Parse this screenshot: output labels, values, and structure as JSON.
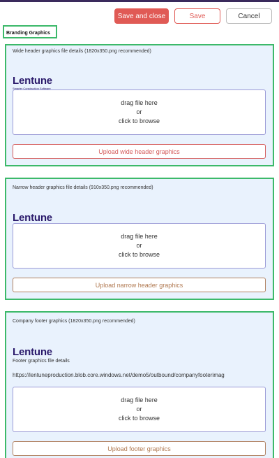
{
  "toolbar": {
    "save_close_label": "Save and close",
    "save_label": "Save",
    "cancel_label": "Cancel"
  },
  "section": {
    "title": "Branding Graphics"
  },
  "panels": [
    {
      "label": "Wide header graphics file details (1820x350.png recommended)",
      "logo_text": "Lentune",
      "logo_tagline": "Smarter Construction Software",
      "drop_line1": "drag file here",
      "drop_line2": "or",
      "drop_line3": "click to browse",
      "upload_label": "Upload wide header graphics"
    },
    {
      "label": "Narrow header graphics file details (910x350.png recommended)",
      "logo_text": "Lentune",
      "drop_line1": "drag file here",
      "drop_line2": "or",
      "drop_line3": "click to browse",
      "upload_label": "Upload narrow header graphics"
    },
    {
      "label": "Company footer graphics (1820x350.png recommended)",
      "logo_text": "Lentune",
      "detail_label": "Footer graphics file details",
      "url": "https://lentuneproduction.blob.core.windows.net/demo5/outbound/companyfooterimag",
      "drop_line1": "drag file here",
      "drop_line2": "or",
      "drop_line3": "click to browse",
      "upload_label": "Upload footer graphics"
    }
  ],
  "colors": {
    "accent": "#e05a55",
    "panel_bg": "#e9f2fd",
    "highlight_border": "#3cb96a",
    "logo": "#2a1a6b"
  }
}
